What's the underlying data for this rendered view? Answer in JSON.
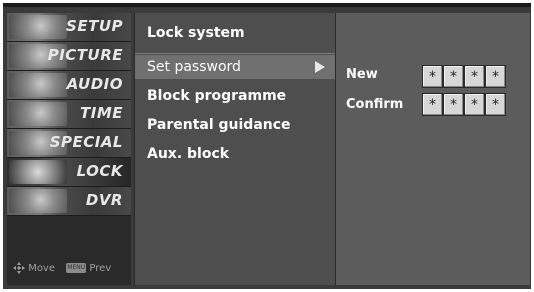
{
  "sidebar": {
    "categories": [
      {
        "label": "SETUP"
      },
      {
        "label": "PICTURE"
      },
      {
        "label": "AUDIO"
      },
      {
        "label": "TIME"
      },
      {
        "label": "SPECIAL"
      },
      {
        "label": "LOCK",
        "active": true
      },
      {
        "label": "DVR"
      }
    ],
    "hints": {
      "move": "Move",
      "prev": "Prev",
      "menu_key": "MENU"
    }
  },
  "menu": {
    "title": "Lock system",
    "items": [
      {
        "label": "Set password",
        "selected": true
      },
      {
        "label": "Block programme"
      },
      {
        "label": "Parental guidance"
      },
      {
        "label": "Aux. block"
      }
    ]
  },
  "password_panel": {
    "new_label": "New",
    "confirm_label": "Confirm",
    "new_digits": [
      "*",
      "*",
      "*",
      "*"
    ],
    "confirm_digits": [
      "*",
      "*",
      "*",
      "*"
    ]
  },
  "colors": {
    "screen_bg": "#3a3a3a",
    "menu_bg": "#4e4e4e",
    "selected_bg": "#707070",
    "panel_bg": "#5c5c5c"
  }
}
